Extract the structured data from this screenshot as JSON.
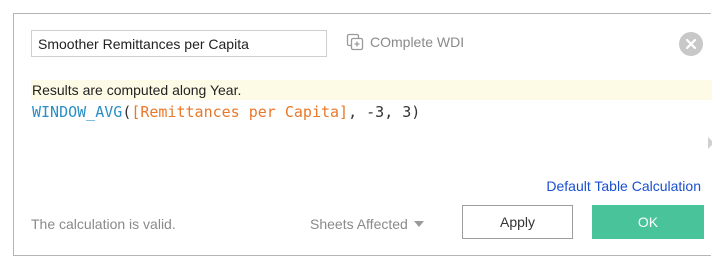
{
  "header": {
    "calc_name_value": "Smoother Remittances per Capita",
    "datasource_label": "COmplete WDI"
  },
  "editor": {
    "hint": "Results are computed along Year.",
    "code": {
      "function": "WINDOW_AVG",
      "open_paren": "(",
      "field": "[Remittances per Capita]",
      "args": ", -3, 3)"
    }
  },
  "links": {
    "default_table_calc": "Default Table Calculation"
  },
  "footer": {
    "status": "The calculation is valid.",
    "sheets_affected": "Sheets Affected",
    "apply": "Apply",
    "ok": "OK"
  },
  "colors": {
    "function": "#2b8ec6",
    "field": "#e8782a",
    "ok_button": "#49c39a",
    "link": "#1a4fcf",
    "hint_background": "#fdfbe6"
  },
  "icons": {
    "datasource": "datasource-icon",
    "close": "close-icon",
    "dropdown": "caret-down-icon"
  }
}
